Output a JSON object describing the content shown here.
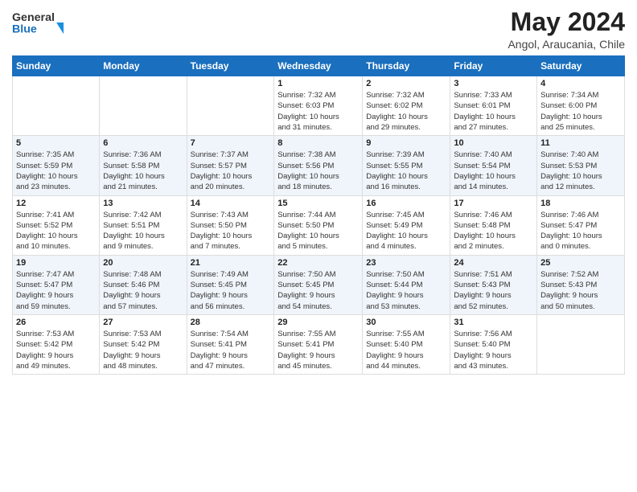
{
  "header": {
    "logo_line1": "General",
    "logo_line2": "Blue",
    "title": "May 2024",
    "location": "Angol, Araucania, Chile"
  },
  "weekdays": [
    "Sunday",
    "Monday",
    "Tuesday",
    "Wednesday",
    "Thursday",
    "Friday",
    "Saturday"
  ],
  "weeks": [
    [
      {
        "day": "",
        "info": ""
      },
      {
        "day": "",
        "info": ""
      },
      {
        "day": "",
        "info": ""
      },
      {
        "day": "1",
        "info": "Sunrise: 7:32 AM\nSunset: 6:03 PM\nDaylight: 10 hours\nand 31 minutes."
      },
      {
        "day": "2",
        "info": "Sunrise: 7:32 AM\nSunset: 6:02 PM\nDaylight: 10 hours\nand 29 minutes."
      },
      {
        "day": "3",
        "info": "Sunrise: 7:33 AM\nSunset: 6:01 PM\nDaylight: 10 hours\nand 27 minutes."
      },
      {
        "day": "4",
        "info": "Sunrise: 7:34 AM\nSunset: 6:00 PM\nDaylight: 10 hours\nand 25 minutes."
      }
    ],
    [
      {
        "day": "5",
        "info": "Sunrise: 7:35 AM\nSunset: 5:59 PM\nDaylight: 10 hours\nand 23 minutes."
      },
      {
        "day": "6",
        "info": "Sunrise: 7:36 AM\nSunset: 5:58 PM\nDaylight: 10 hours\nand 21 minutes."
      },
      {
        "day": "7",
        "info": "Sunrise: 7:37 AM\nSunset: 5:57 PM\nDaylight: 10 hours\nand 20 minutes."
      },
      {
        "day": "8",
        "info": "Sunrise: 7:38 AM\nSunset: 5:56 PM\nDaylight: 10 hours\nand 18 minutes."
      },
      {
        "day": "9",
        "info": "Sunrise: 7:39 AM\nSunset: 5:55 PM\nDaylight: 10 hours\nand 16 minutes."
      },
      {
        "day": "10",
        "info": "Sunrise: 7:40 AM\nSunset: 5:54 PM\nDaylight: 10 hours\nand 14 minutes."
      },
      {
        "day": "11",
        "info": "Sunrise: 7:40 AM\nSunset: 5:53 PM\nDaylight: 10 hours\nand 12 minutes."
      }
    ],
    [
      {
        "day": "12",
        "info": "Sunrise: 7:41 AM\nSunset: 5:52 PM\nDaylight: 10 hours\nand 10 minutes."
      },
      {
        "day": "13",
        "info": "Sunrise: 7:42 AM\nSunset: 5:51 PM\nDaylight: 10 hours\nand 9 minutes."
      },
      {
        "day": "14",
        "info": "Sunrise: 7:43 AM\nSunset: 5:50 PM\nDaylight: 10 hours\nand 7 minutes."
      },
      {
        "day": "15",
        "info": "Sunrise: 7:44 AM\nSunset: 5:50 PM\nDaylight: 10 hours\nand 5 minutes."
      },
      {
        "day": "16",
        "info": "Sunrise: 7:45 AM\nSunset: 5:49 PM\nDaylight: 10 hours\nand 4 minutes."
      },
      {
        "day": "17",
        "info": "Sunrise: 7:46 AM\nSunset: 5:48 PM\nDaylight: 10 hours\nand 2 minutes."
      },
      {
        "day": "18",
        "info": "Sunrise: 7:46 AM\nSunset: 5:47 PM\nDaylight: 10 hours\nand 0 minutes."
      }
    ],
    [
      {
        "day": "19",
        "info": "Sunrise: 7:47 AM\nSunset: 5:47 PM\nDaylight: 9 hours\nand 59 minutes."
      },
      {
        "day": "20",
        "info": "Sunrise: 7:48 AM\nSunset: 5:46 PM\nDaylight: 9 hours\nand 57 minutes."
      },
      {
        "day": "21",
        "info": "Sunrise: 7:49 AM\nSunset: 5:45 PM\nDaylight: 9 hours\nand 56 minutes."
      },
      {
        "day": "22",
        "info": "Sunrise: 7:50 AM\nSunset: 5:45 PM\nDaylight: 9 hours\nand 54 minutes."
      },
      {
        "day": "23",
        "info": "Sunrise: 7:50 AM\nSunset: 5:44 PM\nDaylight: 9 hours\nand 53 minutes."
      },
      {
        "day": "24",
        "info": "Sunrise: 7:51 AM\nSunset: 5:43 PM\nDaylight: 9 hours\nand 52 minutes."
      },
      {
        "day": "25",
        "info": "Sunrise: 7:52 AM\nSunset: 5:43 PM\nDaylight: 9 hours\nand 50 minutes."
      }
    ],
    [
      {
        "day": "26",
        "info": "Sunrise: 7:53 AM\nSunset: 5:42 PM\nDaylight: 9 hours\nand 49 minutes."
      },
      {
        "day": "27",
        "info": "Sunrise: 7:53 AM\nSunset: 5:42 PM\nDaylight: 9 hours\nand 48 minutes."
      },
      {
        "day": "28",
        "info": "Sunrise: 7:54 AM\nSunset: 5:41 PM\nDaylight: 9 hours\nand 47 minutes."
      },
      {
        "day": "29",
        "info": "Sunrise: 7:55 AM\nSunset: 5:41 PM\nDaylight: 9 hours\nand 45 minutes."
      },
      {
        "day": "30",
        "info": "Sunrise: 7:55 AM\nSunset: 5:40 PM\nDaylight: 9 hours\nand 44 minutes."
      },
      {
        "day": "31",
        "info": "Sunrise: 7:56 AM\nSunset: 5:40 PM\nDaylight: 9 hours\nand 43 minutes."
      },
      {
        "day": "",
        "info": ""
      }
    ]
  ]
}
